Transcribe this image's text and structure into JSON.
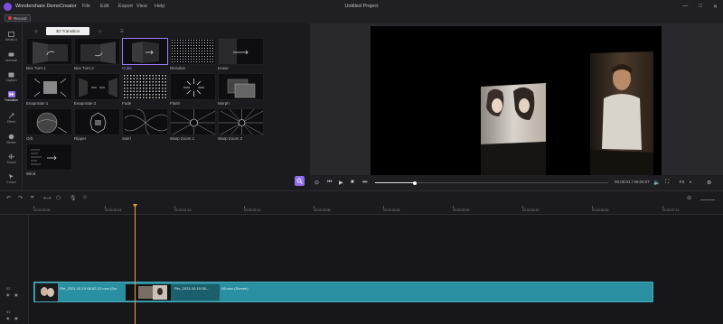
{
  "titlebar": {
    "app_name": "Wondershare DemoCreator",
    "menu": [
      "File",
      "Edit",
      "Export",
      "View",
      "Help"
    ],
    "project_title": "Untitled Project"
  },
  "recbar": {
    "record_label": "Record"
  },
  "sidebar": {
    "items": [
      {
        "label": "Media Li",
        "icon": "media-library-icon"
      },
      {
        "label": "Annotati",
        "icon": "annotation-icon"
      },
      {
        "label": "Caption",
        "icon": "caption-icon"
      },
      {
        "label": "Transition",
        "icon": "transition-icon",
        "active": true
      },
      {
        "label": "Effect",
        "icon": "effect-icon"
      },
      {
        "label": "Sticker",
        "icon": "sticker-icon"
      },
      {
        "label": "Sound",
        "icon": "sound-icon"
      },
      {
        "label": "Cursor",
        "icon": "cursor-icon"
      }
    ]
  },
  "library": {
    "tabs": [
      "",
      "3D Transition",
      "",
      ""
    ],
    "active_tab": 1,
    "tiles": [
      {
        "label": "Box Turn 1"
      },
      {
        "label": "Box Turn 2"
      },
      {
        "label": "Cube",
        "selected": true
      },
      {
        "label": "Dissolve"
      },
      {
        "label": "Erase"
      },
      {
        "label": "Evaporate 1"
      },
      {
        "label": "Evaporate 2"
      },
      {
        "label": "Fade"
      },
      {
        "label": "Flash"
      },
      {
        "label": "Morph"
      },
      {
        "label": "Orb"
      },
      {
        "label": "Ripper"
      },
      {
        "label": "Swirl"
      },
      {
        "label": "Warp Zoom 1"
      },
      {
        "label": "Warp Zoom 2"
      },
      {
        "label": "Wind"
      }
    ]
  },
  "preview": {
    "timecode": "00:00:01 / 00:00:07",
    "progress": 0.17,
    "ratio_label": "Fit"
  },
  "ruler": {
    "ticks": [
      "00:00:00:00",
      "00:00:00:16",
      "00:00:01:16",
      "00:00:02:12",
      "00:00:03:08",
      "00:00:04:04",
      "00:00:05:00",
      "00:00:05:20",
      "00:00:06:16",
      "00:00:07:12"
    ]
  },
  "timeline": {
    "track_labels": [
      "02",
      "01"
    ],
    "clip_names": [
      "File_2021-10-19 08-52-12.mov (Scr",
      "File_2021-10-19 08-...",
      "08.mov (Screen)"
    ]
  },
  "colors": {
    "accent": "#8f6cf0",
    "clip": "#2a8fa0",
    "playhead": "#f0a030"
  }
}
